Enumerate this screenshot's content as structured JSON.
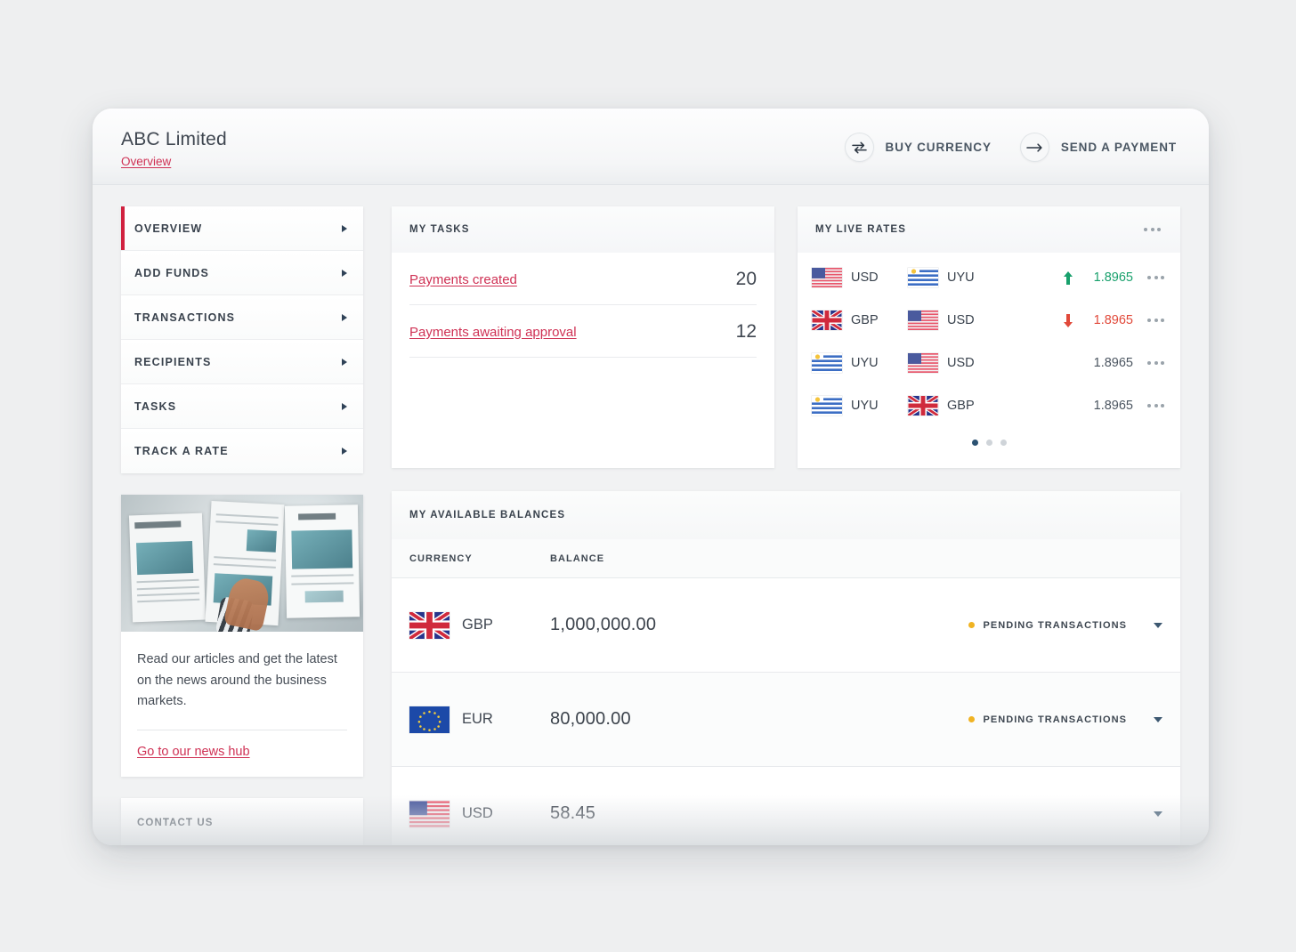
{
  "header": {
    "company": "ABC Limited",
    "breadcrumb": "Overview",
    "actions": [
      {
        "label": "BUY CURRENCY",
        "icon": "exchange-icon"
      },
      {
        "label": "SEND A PAYMENT",
        "icon": "arrow-right-icon"
      }
    ]
  },
  "sidebar": {
    "items": [
      {
        "label": "OVERVIEW",
        "active": true
      },
      {
        "label": "ADD FUNDS",
        "active": false
      },
      {
        "label": "TRANSACTIONS",
        "active": false
      },
      {
        "label": "RECIPIENTS",
        "active": false
      },
      {
        "label": "TASKS",
        "active": false
      },
      {
        "label": "TRACK A RATE",
        "active": false
      }
    ]
  },
  "promo": {
    "text": "Read our articles and get the latest on the news around the business markets.",
    "link": "Go to our news hub"
  },
  "contact": {
    "label": "CONTACT US"
  },
  "tasks": {
    "title": "MY TASKS",
    "rows": [
      {
        "name": "Payments created",
        "count": "20"
      },
      {
        "name": "Payments awaiting approval",
        "count": "12"
      }
    ]
  },
  "rates": {
    "title": "MY LIVE RATES",
    "menu_icon": "ellipsis-icon",
    "rows": [
      {
        "from": "USD",
        "to": "UYU",
        "value": "1.8965",
        "trend": "up"
      },
      {
        "from": "GBP",
        "to": "USD",
        "value": "1.8965",
        "trend": "down"
      },
      {
        "from": "UYU",
        "to": "USD",
        "value": "1.8965",
        "trend": "none"
      },
      {
        "from": "UYU",
        "to": "GBP",
        "value": "1.8965",
        "trend": "none"
      }
    ],
    "pages": 3,
    "active_page": 1
  },
  "balances": {
    "title": "MY AVAILABLE BALANCES",
    "columns": [
      "CURRENCY",
      "BALANCE"
    ],
    "pending_label": "PENDING TRANSACTIONS",
    "rows": [
      {
        "currency": "GBP",
        "balance": "1,000,000.00",
        "pending": true
      },
      {
        "currency": "EUR",
        "balance": "80,000.00",
        "pending": true
      },
      {
        "currency": "USD",
        "balance": "58.45",
        "pending": false
      }
    ]
  },
  "colors": {
    "accent_red": "#cf3154",
    "active_bar": "#d0213f",
    "up_green": "#18a06c",
    "down_red": "#e1493a",
    "pending_amber": "#f0b323",
    "navy": "#2b5272"
  }
}
